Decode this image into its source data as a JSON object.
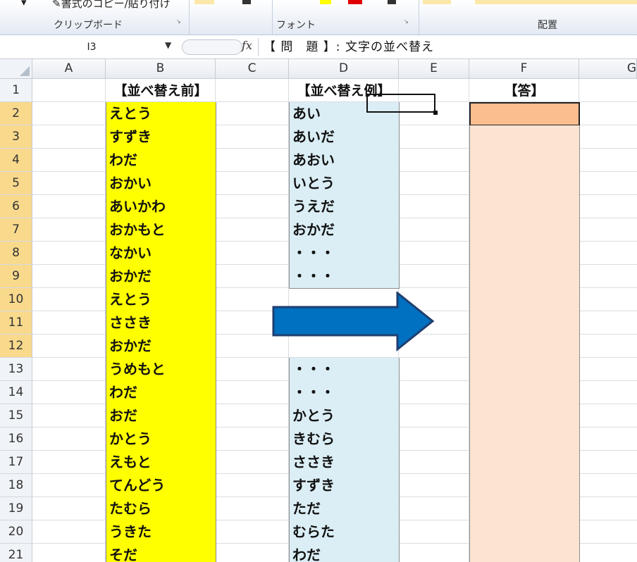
{
  "ribbon": {
    "groups": [
      {
        "label": "クリップボード"
      },
      {
        "label": "フォント"
      },
      {
        "label": "配置"
      }
    ],
    "clipboard_cmd": "書式のコピー/貼り付け"
  },
  "formula_bar": {
    "name_box": "I3",
    "fx_label": "fx",
    "content": "【 問　題 】:  文字の並べ替え"
  },
  "columns": [
    "A",
    "B",
    "C",
    "D",
    "E",
    "F",
    "G"
  ],
  "rows": [
    "1",
    "2",
    "3",
    "4",
    "5",
    "6",
    "7",
    "8",
    "9",
    "10",
    "11",
    "12",
    "13",
    "14",
    "15",
    "16",
    "17",
    "18",
    "19",
    "20",
    "21"
  ],
  "headers": {
    "b1": "【並べ替え前】",
    "d1": "【並べ替え例】",
    "f1": "【答】"
  },
  "column_b": [
    "えとう",
    "すずき",
    "わだ",
    "おかい",
    "あいかわ",
    "おかもと",
    "なかい",
    "おかだ",
    "えとう",
    "ささき",
    "おかだ",
    "うめもと",
    "わだ",
    "おだ",
    "かとう",
    "えもと",
    "てんどう",
    "たむら",
    "うきた",
    "そだ"
  ],
  "column_d_top": [
    "あい",
    "あいだ",
    "あおい",
    "いとう",
    "うえだ",
    "おかだ",
    "・・・",
    "・・・"
  ],
  "column_d_bottom": [
    "・・・",
    "・・・",
    "かとう",
    "きむら",
    "ささき",
    "すずき",
    "ただ",
    "むらた",
    "わだ"
  ],
  "colors": {
    "before_fill": "#ffff00",
    "example_fill": "#dbeef5",
    "answer_fill": "#fde4d1",
    "answer_active_fill": "#fbbe8f",
    "arrow_fill": "#0070c0",
    "arrow_stroke": "#1f3f6f"
  },
  "icons": {
    "fx": "function-icon",
    "arrow": "right-arrow-shape"
  }
}
